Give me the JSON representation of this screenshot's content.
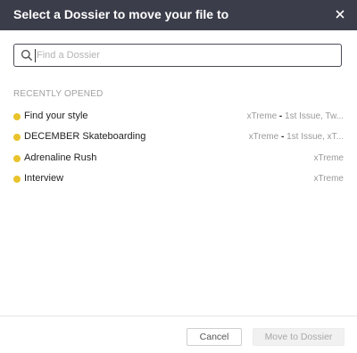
{
  "dialog": {
    "title": "Select a Dossier to move your file to",
    "close_icon": "close-icon"
  },
  "search": {
    "placeholder": "Find a Dossier",
    "value": "",
    "icon": "search-icon"
  },
  "section": {
    "label": "RECENTLY OPENED"
  },
  "items": [
    {
      "name": "Find your style",
      "publication": "xTreme",
      "separator": " - ",
      "issue": "1st Issue, Tw..."
    },
    {
      "name": "DECEMBER Skateboarding",
      "publication": "xTreme",
      "separator": " - ",
      "issue": "1st Issue, xT..."
    },
    {
      "name": "Adrenaline Rush",
      "publication": "xTreme",
      "separator": "",
      "issue": ""
    },
    {
      "name": "Interview",
      "publication": "xTreme",
      "separator": "",
      "issue": ""
    }
  ],
  "footer": {
    "cancel_label": "Cancel",
    "move_label": "Move to Dossier"
  },
  "colors": {
    "header_bg": "#3b3d4a",
    "status_dot": "#e8c32c"
  }
}
